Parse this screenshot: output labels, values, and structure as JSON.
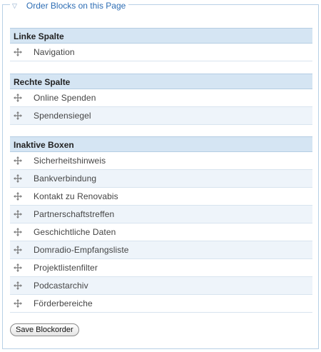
{
  "legend": {
    "label": "Order Blocks on this Page",
    "collapse_icon": "triangle-down-icon"
  },
  "groups": [
    {
      "title": "Linke Spalte",
      "items": [
        "Navigation"
      ]
    },
    {
      "title": "Rechte Spalte",
      "items": [
        "Online Spenden",
        "Spendensiegel"
      ]
    },
    {
      "title": "Inaktive Boxen",
      "items": [
        "Sicherheitshinweis",
        "Bankverbindung",
        "Kontakt zu Renovabis",
        "Partnerschaftstreffen",
        "Geschichtliche Daten",
        "Domradio-Empfangsliste",
        "Projektlistenfilter",
        "Podcastarchiv",
        "Förderbereiche"
      ]
    }
  ],
  "drag_icon": "move-handle-icon",
  "save_button": {
    "label": "Save Blockorder"
  },
  "colors": {
    "header_bg": "#d5e5f3",
    "row_alt_bg": "#eef4fa",
    "link": "#2d6db4",
    "border": "#b8d0e6"
  }
}
